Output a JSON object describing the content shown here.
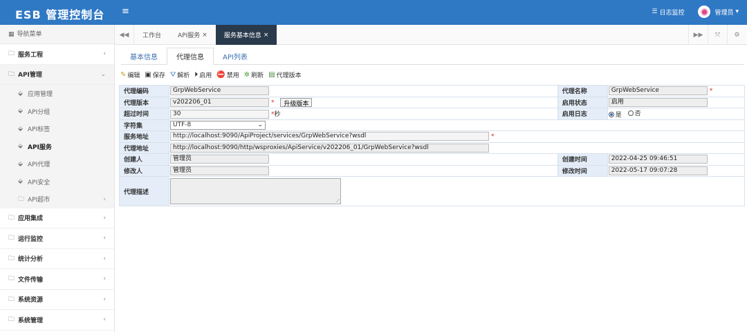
{
  "header": {
    "brand": "ESB 管理控制台",
    "menu_toggle": "≡",
    "log_label": "日志监控",
    "user_label": "管理员",
    "user_caret": "▾"
  },
  "sidebar": {
    "title": "导航菜单",
    "items": [
      {
        "label": "服务工程",
        "icon": "folder-icon",
        "arrow": "‹"
      },
      {
        "label": "API管理",
        "icon": "folder-icon",
        "arrow": "⌄"
      },
      {
        "label": "应用集成",
        "icon": "folder-icon",
        "arrow": "‹"
      },
      {
        "label": "运行监控",
        "icon": "folder-icon",
        "arrow": "‹"
      },
      {
        "label": "统计分析",
        "icon": "folder-icon",
        "arrow": "‹"
      },
      {
        "label": "文件传输",
        "icon": "folder-icon",
        "arrow": "‹"
      },
      {
        "label": "系统资源",
        "icon": "folder-icon",
        "arrow": "‹"
      },
      {
        "label": "系统管理",
        "icon": "folder-icon",
        "arrow": "‹"
      }
    ],
    "api_sub": [
      {
        "label": "应用管理"
      },
      {
        "label": "API分组"
      },
      {
        "label": "API标签"
      },
      {
        "label": "API服务"
      },
      {
        "label": "API代理"
      },
      {
        "label": "API安全"
      },
      {
        "label": "API超市",
        "arrow": "‹"
      }
    ]
  },
  "tabbar": {
    "tabs": [
      {
        "label": "工作台"
      },
      {
        "label": "API服务",
        "close": "×"
      },
      {
        "label": "服务基本信息",
        "close": "×"
      }
    ]
  },
  "subtabs": [
    "基本信息",
    "代理信息",
    "API列表"
  ],
  "toolbar": {
    "edit": "编辑",
    "save": "保存",
    "parse": "解析",
    "enable": "启用",
    "disable": "禁用",
    "refresh": "刷新",
    "proxy_version": "代理版本"
  },
  "form": {
    "proxy_code_label": "代理编码",
    "proxy_code": "GrpWebService",
    "proxy_name_label": "代理名称",
    "proxy_name": "GrpWebService",
    "proxy_version_label": "代理版本",
    "proxy_version": "v202206_01",
    "upgrade_btn": "升级版本",
    "enable_status_label": "启用状态",
    "enable_status": "启用",
    "timeout_label": "超过时间",
    "timeout": "30",
    "timeout_unit": "秒",
    "enable_log_label": "启用日志",
    "log_yes": "是",
    "log_no": "否",
    "charset_label": "字符集",
    "charset": "UTF-8",
    "service_url_label": "服务地址",
    "service_url": "http://localhost:9090/ApiProject/services/GrpWebService?wsdl",
    "proxy_url_label": "代理地址",
    "proxy_url": "http://localhost:9090/http/wsproxies/ApiService/v202206_01/GrpWebService?wsdl",
    "creator_label": "创建人",
    "creator": "管理员",
    "create_time_label": "创建时间",
    "create_time": "2022-04-25 09:46:51",
    "modifier_label": "修改人",
    "modifier": "管理员",
    "modify_time_label": "修改时间",
    "modify_time": "2022-05-17 09:07:28",
    "desc_label": "代理描述",
    "required_mark": "*"
  }
}
